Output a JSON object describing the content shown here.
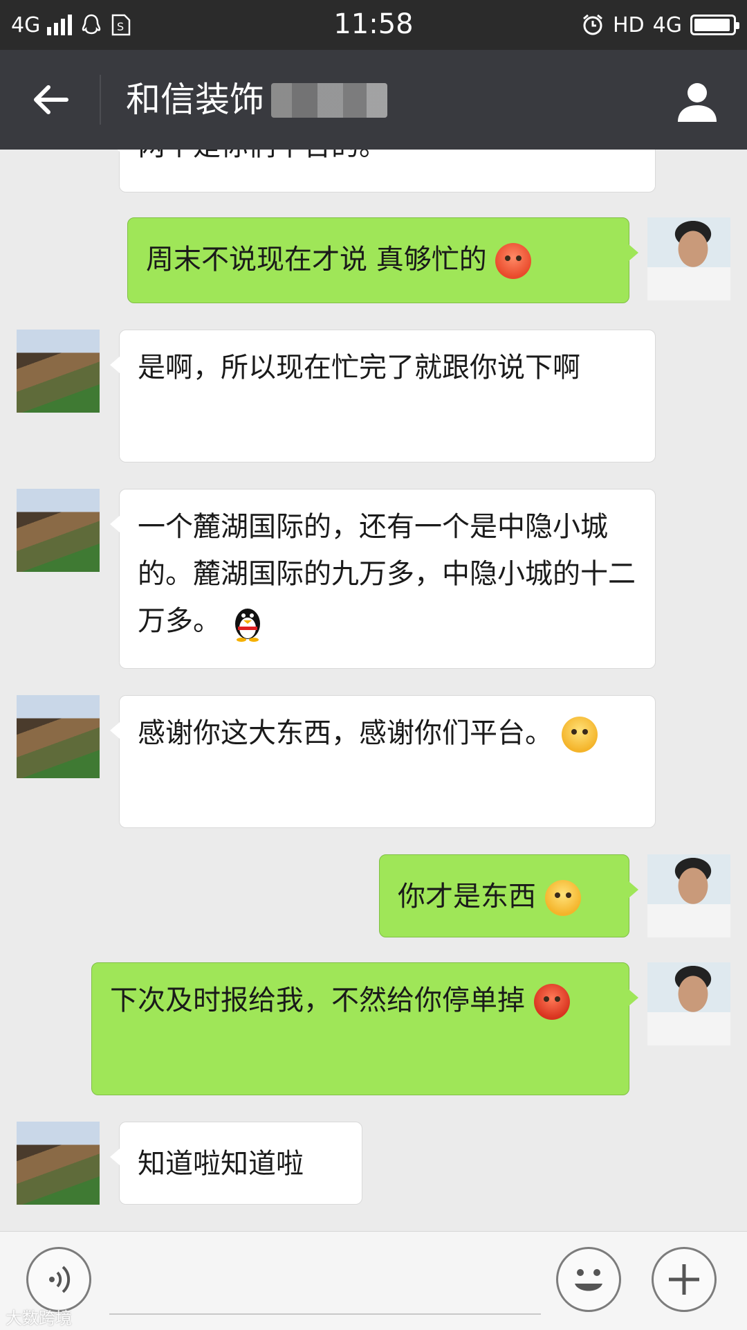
{
  "status_bar": {
    "network_left": "4G",
    "time": "11:58",
    "hd": "HD",
    "network_right": "4G",
    "icons": [
      "signal-icon",
      "qq-icon",
      "sim-icon",
      "alarm-icon",
      "battery-icon"
    ],
    "battery_level": 0.95
  },
  "header": {
    "title": "和信装饰",
    "back_icon": "back-arrow-icon",
    "profile_icon": "contact-profile-icon",
    "bg_color": "#393a3f"
  },
  "messages": [
    {
      "from": "other",
      "text": "两个是你们平台的。",
      "partial": true
    },
    {
      "from": "self",
      "text": "周末不说现在才说  真够忙的",
      "emoji": "blush-emoji"
    },
    {
      "from": "other",
      "text": "是啊，所以现在忙完了就跟你说下啊"
    },
    {
      "from": "other",
      "text": "一个麓湖国际的，还有一个是中隐小城的。麓湖国际的九万多，中隐小城的十二万多。",
      "emoji": "penguin-emoji"
    },
    {
      "from": "other",
      "text": "感谢你这大东西，感谢你们平台。",
      "emoji": "smirk-emoji"
    },
    {
      "from": "self",
      "text": "你才是东西",
      "emoji": "unamused-emoji"
    },
    {
      "from": "self",
      "text": "下次及时报给我，不然给你停单掉",
      "emoji": "angry-emoji"
    },
    {
      "from": "other",
      "text": "知道啦知道啦"
    }
  ],
  "input_bar": {
    "voice_icon": "voice-icon",
    "emoji_icon": "emoji-face-icon",
    "plus_icon": "plus-icon"
  },
  "watermark": "大数跨境",
  "colors": {
    "outgoing_bubble": "#9fe658",
    "incoming_bubble": "#ffffff",
    "chat_background": "#ebebeb"
  }
}
